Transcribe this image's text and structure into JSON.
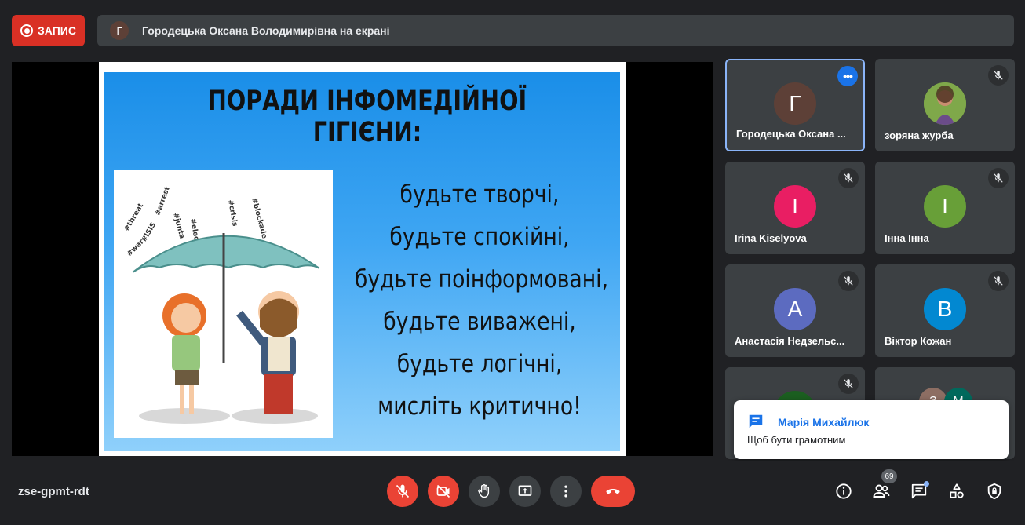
{
  "recording": {
    "label": "ЗАПИС",
    "color": "#d93025"
  },
  "presentation": {
    "avatar_letter": "Г",
    "text": "Городецька Оксана Володимирівна на екрані"
  },
  "slide": {
    "title": "ПОРАДИ ІНФОМЕДІЙНОЇ ГІГІЄНИ:",
    "lines": [
      "будьте творчі,",
      "будьте спокійні,",
      "будьте поінформовані,",
      "будьте виважені,",
      "будьте логічні,",
      "мисліть критично!"
    ],
    "picture_hashtags": [
      "#elections",
      "#arrest",
      "#junta",
      "#crisis",
      "#blockade",
      "#threat",
      "#ISIS",
      "#war"
    ]
  },
  "participants": [
    {
      "name": "Городецька Оксана ...",
      "letter": "Г",
      "color": "#5d4037",
      "active": true,
      "muted": false
    },
    {
      "name": "зоряна журба",
      "letter": "",
      "color": "#6a8f3a",
      "photo": true,
      "muted": true
    },
    {
      "name": "Irina Kiselyova",
      "letter": "I",
      "color": "#e91e63",
      "muted": true
    },
    {
      "name": "Інна Інна",
      "letter": "І",
      "color": "#689f38",
      "muted": true
    },
    {
      "name": "Анастасія Недзельс...",
      "letter": "А",
      "color": "#5c6bc0",
      "muted": true
    },
    {
      "name": "Віктор Кожан",
      "letter": "В",
      "color": "#0288d1",
      "muted": true
    }
  ],
  "more_tiles": {
    "letters": [
      "З",
      "М"
    ]
  },
  "chat_notification": {
    "sender": "Марія Михайлюк",
    "message": "Щоб бути грамотним"
  },
  "meeting_code": "zse-gpmt-rdt",
  "participant_count": "69",
  "controls": {
    "mic": "mic-off-icon",
    "camera": "camera-off-icon",
    "hand": "raise-hand-icon",
    "present": "present-icon",
    "more": "more-options-icon",
    "hangup": "hangup-icon"
  },
  "right_icons": [
    "info-icon",
    "people-icon",
    "chat-icon",
    "activities-icon",
    "host-controls-icon"
  ]
}
